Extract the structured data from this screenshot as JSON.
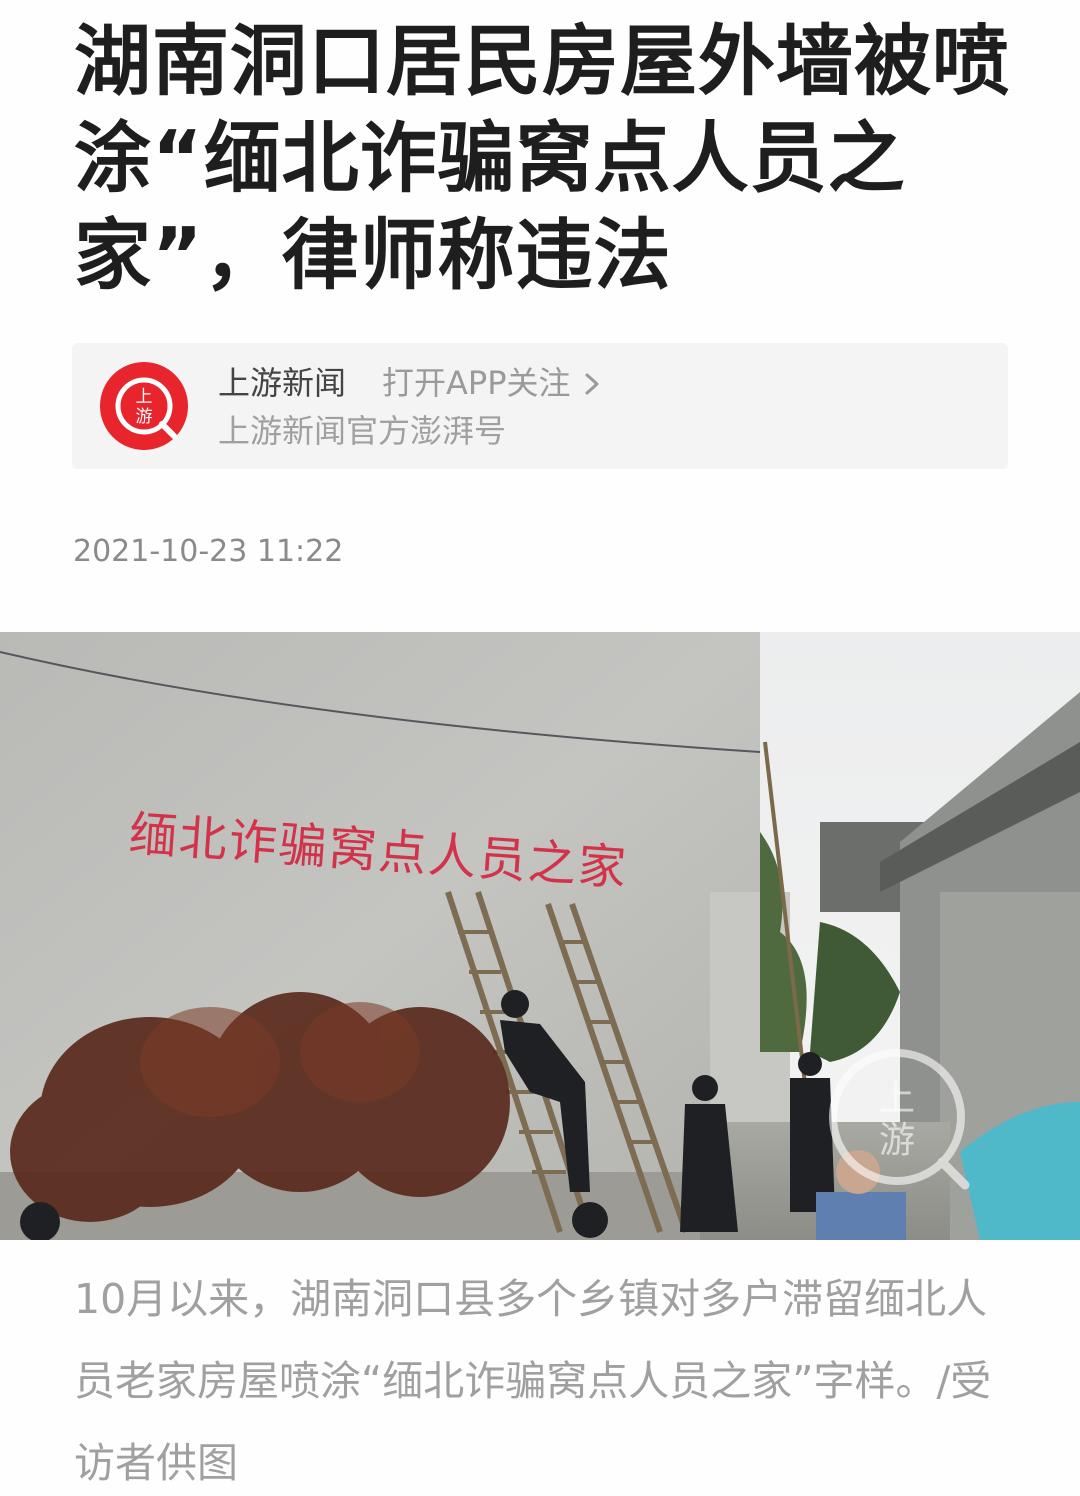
{
  "article": {
    "headline": "湖南洞口居民房屋外墙被喷涂“缅北诈骗窝点人员之家”，律师称违法",
    "timestamp": "2021-10-23 11:22",
    "caption": "10月以来，湖南洞口县多个乡镇对多户滞留缅北人员老家房屋喷涂“缅北诈骗窝点人员之家”字样。/受访者供图"
  },
  "source": {
    "name": "上游新闻",
    "follow_label": "打开APP关注",
    "subtitle": "上游新闻官方澎湃号",
    "logo_text": "上游",
    "logo_color": "#e8242d"
  },
  "photo": {
    "wall_slogan": "缅北诈骗窝点人员之家",
    "watermark": "上游",
    "slogan_color": "#d2334a"
  },
  "icons": {
    "follow_chevron": "chevron-right-icon",
    "logo": "shangyou-logo-icon"
  }
}
